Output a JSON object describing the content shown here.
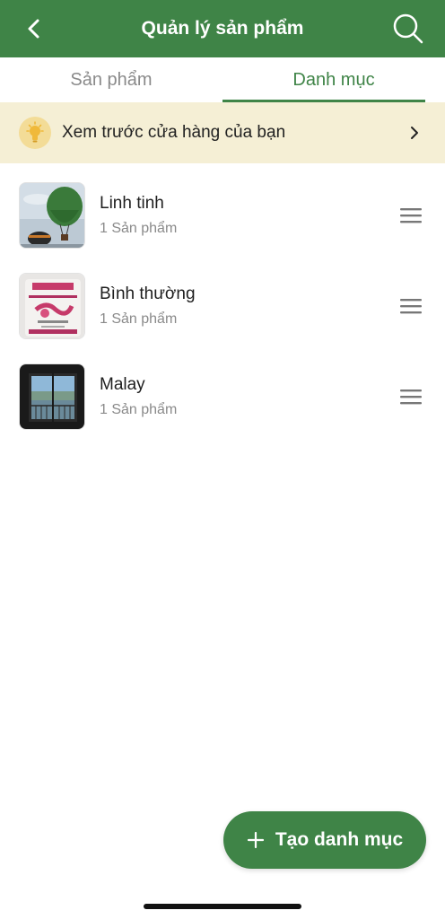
{
  "header": {
    "title": "Quản lý sản phẩm",
    "back_icon": "chevron-left-icon",
    "search_icon": "search-icon"
  },
  "tabs": [
    {
      "label": "Sản phẩm",
      "active": false
    },
    {
      "label": "Danh mục",
      "active": true
    }
  ],
  "banner": {
    "text": "Xem trước cửa hàng của bạn",
    "icon": "lightbulb-icon"
  },
  "categories": [
    {
      "name": "Linh tinh",
      "count": "1 Sản phẩm",
      "thumb": "hot-air-balloon-photo"
    },
    {
      "name": "Bình thường",
      "count": "1 Sản phẩm",
      "thumb": "rice-bag-photo"
    },
    {
      "name": "Malay",
      "count": "1 Sản phẩm",
      "thumb": "window-view-photo"
    }
  ],
  "fab": {
    "label": "Tạo danh mục",
    "icon": "plus-icon"
  },
  "colors": {
    "primary": "#3f8447",
    "banner_bg": "#f5efd5",
    "muted_text": "#8a8a8a"
  }
}
